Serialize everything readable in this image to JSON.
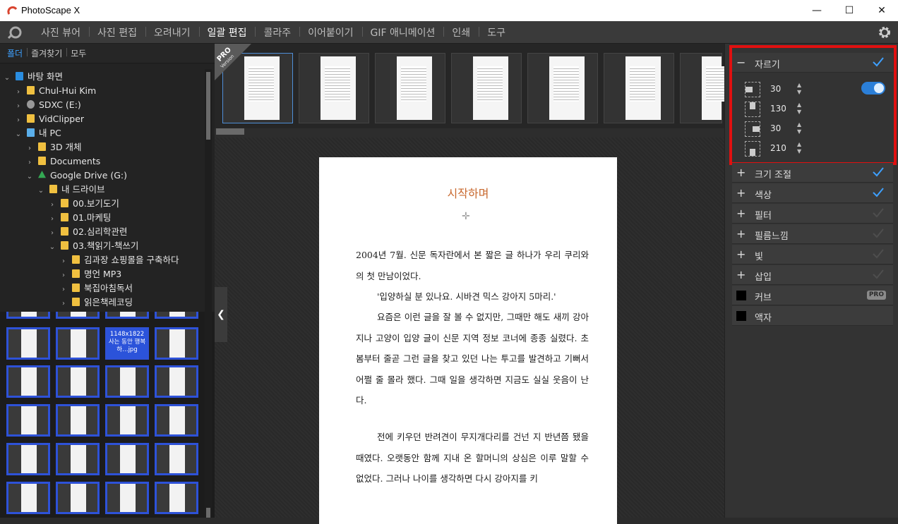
{
  "window": {
    "title": "PhotoScape X",
    "minimize": "—",
    "maximize": "☐",
    "close": "✕"
  },
  "menu": {
    "items": [
      "사진 뷰어",
      "사진 편집",
      "오려내기",
      "일괄 편집",
      "콜라주",
      "이어붙이기",
      "GIF 애니메이션",
      "인쇄",
      "도구"
    ],
    "active": "일괄 편집"
  },
  "left_tabs": [
    "폴더",
    "즐겨찾기",
    "모두"
  ],
  "tree": [
    {
      "label": "바탕 화면",
      "chev": "v",
      "icon": "folder-blue"
    },
    {
      "label": "Chul-Hui Kim",
      "chev": ">",
      "icon": "user-folder"
    },
    {
      "label": "SDXC (E:)",
      "chev": ">",
      "icon": "drive"
    },
    {
      "label": "VidClipper",
      "chev": ">",
      "icon": "folder"
    },
    {
      "label": "내 PC",
      "chev": "v",
      "icon": "pc"
    },
    {
      "label": "3D 개체",
      "chev": ">",
      "icon": "folder"
    },
    {
      "label": "Documents",
      "chev": ">",
      "icon": "folder"
    },
    {
      "label": "Google Drive (G:)",
      "chev": "v",
      "icon": "google-drive"
    },
    {
      "label": "내 드라이브",
      "chev": "v",
      "icon": "folder"
    },
    {
      "label": "00.보기도기",
      "chev": ">",
      "icon": "folder"
    },
    {
      "label": "01.마케팅",
      "chev": ">",
      "icon": "folder"
    },
    {
      "label": "02.심리학관련",
      "chev": ">",
      "icon": "folder"
    },
    {
      "label": "03.책읽기-책쓰기",
      "chev": "v",
      "icon": "folder"
    },
    {
      "label": "김과장 쇼핑몰을 구축하다",
      "chev": ">",
      "icon": "folder"
    },
    {
      "label": "명언 MP3",
      "chev": ">",
      "icon": "folder"
    },
    {
      "label": "북집아침독서",
      "chev": ">",
      "icon": "folder"
    },
    {
      "label": "읽은책레코딩",
      "chev": ">",
      "icon": "folder"
    }
  ],
  "selected_thumb": {
    "size": "1148x1822",
    "name": "사는 동안 행복하…jpg"
  },
  "pro_badge": {
    "top": "PRO",
    "bottom": "Version"
  },
  "page": {
    "title": "시작하며",
    "para1": "2004년 7월. 신문 독자란에서 본 짧은 글 하나가 우리 쿠리와의 첫 만남이었다.",
    "para2": "'입양하실 분 있나요. 시바견 믹스 강아지 5마리.'",
    "para3": "요즘은 이런 글을 잘 볼 수 없지만, 그때만 해도 새끼 강아지나 고양이 입양 글이 신문 지역 정보 코너에 종종 실렸다. 초봄부터 줄곧 그런 글을 찾고 있던 나는 투고를 발견하고 기뻐서 어쩔 줄 몰라 했다. 그때 일을 생각하면 지금도 실실 웃음이 난다.",
    "para4": "전에 키우던 반려견이 무지개다리를 건넌 지 반년쯤 됐을 때였다. 오랫동안 함께 지내 온 할머니의 상심은 이루 말할 수 없었다. 그러나 나이를 생각하면 다시 강아지를 키"
  },
  "crop": {
    "label": "자르기",
    "sign": "−",
    "values": [
      "30",
      "130",
      "30",
      "210"
    ],
    "enabled": true
  },
  "sections": [
    {
      "label": "크기 조절",
      "sign": "+",
      "checked": true,
      "pro": ""
    },
    {
      "label": "색상",
      "sign": "+",
      "checked": true,
      "pro": ""
    },
    {
      "label": "필터",
      "sign": "+",
      "checked": false,
      "pro": ""
    },
    {
      "label": "필름느낌",
      "sign": "+",
      "checked": false,
      "pro": ""
    },
    {
      "label": "빛",
      "sign": "+",
      "checked": false,
      "pro": ""
    },
    {
      "label": "삽입",
      "sign": "+",
      "checked": false,
      "pro": ""
    },
    {
      "label": "커브",
      "sign": "box",
      "checked": false,
      "pro": "PRO"
    },
    {
      "label": "액자",
      "sign": "box",
      "checked": false,
      "pro": ""
    }
  ],
  "colors": {
    "accent": "#3ea0ff",
    "highlight": "#e01010",
    "thumb_border": "#2e52d8"
  }
}
